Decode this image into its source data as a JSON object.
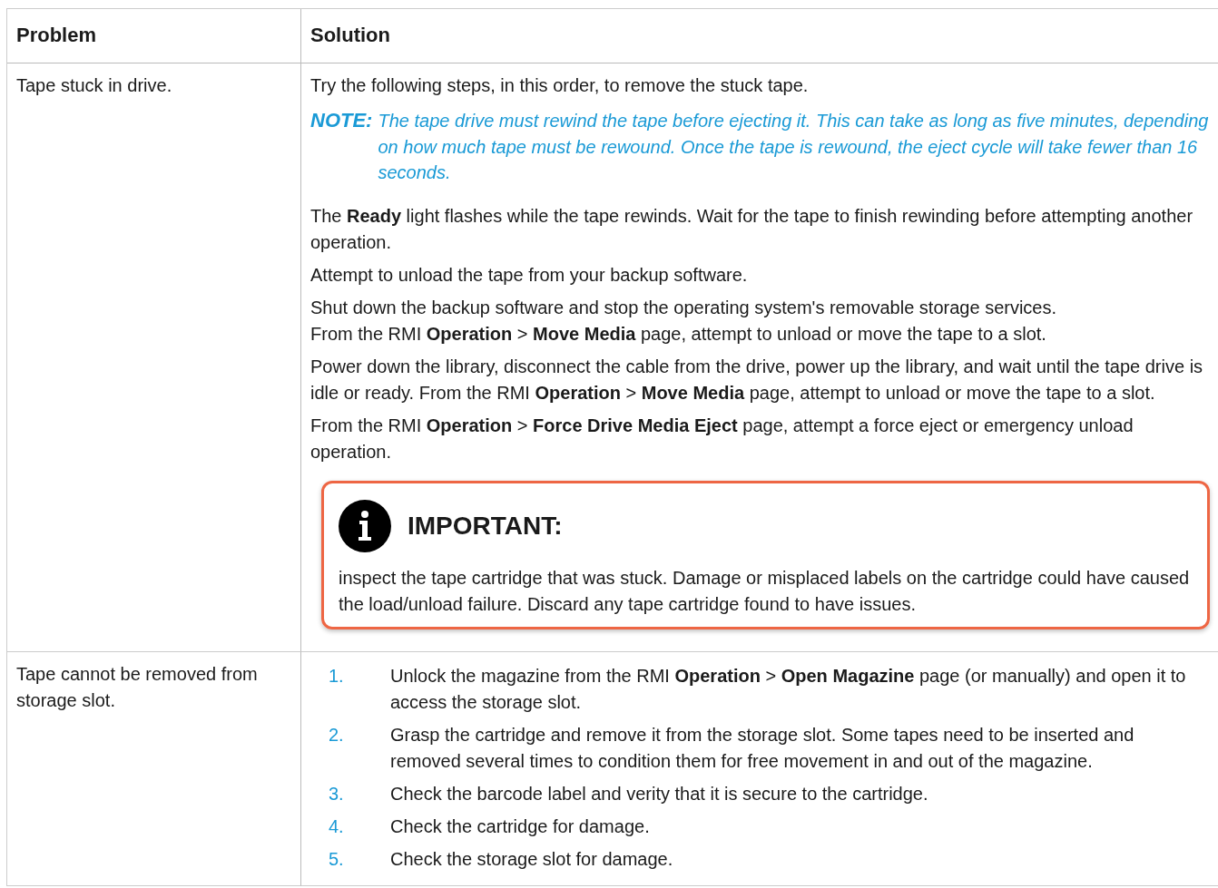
{
  "table": {
    "columns": [
      "Problem",
      "Solution"
    ],
    "rows": [
      {
        "problem": "Tape stuck in drive.",
        "solution": [
          {
            "kind": "paragraph",
            "text": "Try the following steps, in this order, to remove the stuck tape."
          },
          {
            "kind": "note",
            "label": "NOTE:",
            "text": "The tape drive must rewind the tape before ejecting it. This can take as long as five minutes, depending on how much tape must be rewound. Once the tape is rewound, the eject cycle will take fewer than 16 seconds."
          },
          {
            "kind": "paragraph",
            "text": "The **Ready** light flashes while the tape rewinds. Wait for the tape to finish rewinding before attempting another operation."
          },
          {
            "kind": "paragraph",
            "text": "Attempt to unload the tape from your backup software."
          },
          {
            "kind": "lines",
            "lines": [
              "Shut down the backup software and stop the operating system's removable storage services.",
              "From the RMI **Operation** > **Move Media** page, attempt to unload or move the tape to a slot."
            ]
          },
          {
            "kind": "paragraph",
            "text": "Power down the library, disconnect the cable from the drive, power up the library, and wait until the tape drive is idle or ready. From the RMI **Operation** > **Move Media** page, attempt to unload or move the tape to a slot."
          },
          {
            "kind": "paragraph",
            "text": "From the RMI **Operation** > **Force Drive Media Eject** page, attempt a force eject or emergency unload operation."
          },
          {
            "kind": "important",
            "title": "IMPORTANT:",
            "text": "inspect the tape cartridge that was stuck. Damage or misplaced labels on the cartridge could have caused the load/unload failure. Discard any tape cartridge found to have issues."
          }
        ]
      },
      {
        "problem": "Tape cannot be removed from storage slot.",
        "solution": [
          {
            "kind": "list",
            "items": [
              {
                "number": "1.",
                "text": "Unlock the magazine from the RMI **Operation** > **Open Magazine** page (or manually) and open it to access the storage slot."
              },
              {
                "number": "2.",
                "text": "Grasp the cartridge and remove it from the storage slot. Some tapes need to be inserted and removed several times to condition them for free movement in and out of the magazine."
              },
              {
                "number": "3.",
                "text": "Check the barcode label and verity that it is secure to the cartridge."
              },
              {
                "number": "4.",
                "text": "Check the cartridge for damage."
              },
              {
                "number": "5.",
                "text": "Check the storage slot for damage."
              }
            ]
          }
        ]
      }
    ]
  }
}
